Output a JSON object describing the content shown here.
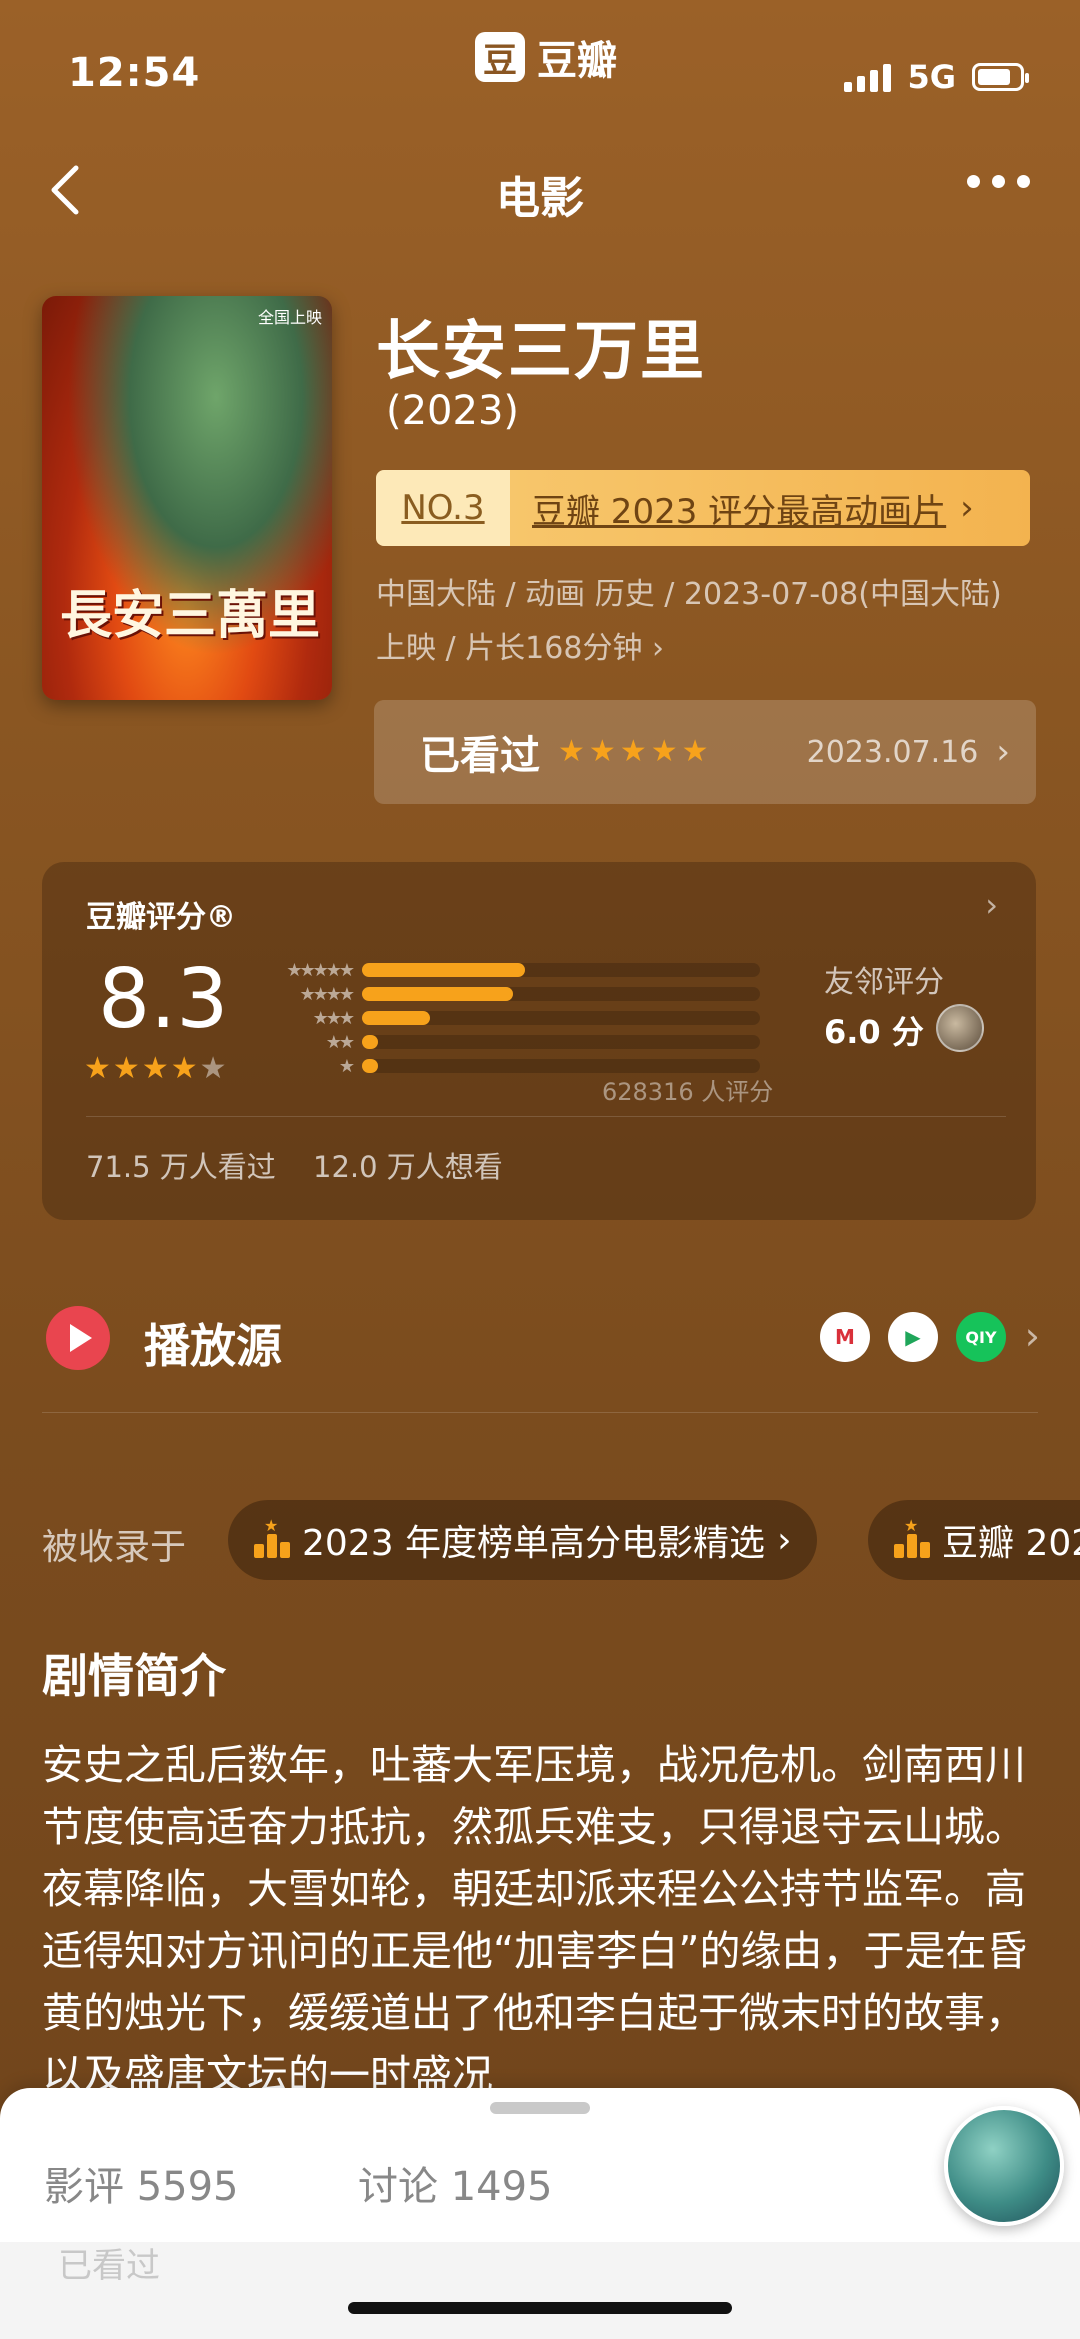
{
  "status_bar": {
    "time": "12:54",
    "network": "5G"
  },
  "app": {
    "logo_char": "豆",
    "name": "豆瓣"
  },
  "nav": {
    "title": "电影"
  },
  "movie": {
    "title": "长安三万里",
    "year": "(2023)",
    "poster_title": "長安三萬里",
    "poster_tag": "全国上映",
    "rank_no": "NO.3",
    "rank_label": "豆瓣 2023 评分最高动画片",
    "meta": "中国大陆 / 动画 历史 / 2023-07-08(中国大陆) 上映 / 片长168分钟",
    "meta_chev": "›"
  },
  "watched": {
    "label": "已看过",
    "stars": 5,
    "date": "2023.07.16",
    "chev": "›"
  },
  "rating": {
    "title": "豆瓣评分®",
    "score": "8.3",
    "stars": 4,
    "distribution": [
      0.41,
      0.38,
      0.17,
      0.04,
      0.04
    ],
    "count": "628316 人评分",
    "friend_label": "友邻评分",
    "friend_score": "6.0 分",
    "watched": "71.5 万人看过",
    "want": "12.0 万人想看",
    "chev": "›"
  },
  "play": {
    "label": "播放源",
    "sources": [
      "M",
      "▶",
      "QIY"
    ],
    "chev": "›"
  },
  "collected": {
    "label": "被收录于",
    "chips": [
      "2023 年度榜单高分电影精选",
      "豆瓣 202"
    ],
    "chev": "›"
  },
  "synopsis": {
    "title": "剧情简介",
    "text": "安史之乱后数年，吐蕃大军压境，战况危机。剑南西川节度使高适奋力抵抗，然孤兵难支，只得退守云山城。夜幕降临，大雪如轮，朝廷却派来程公公持节监军。高适得知对方讯问的正是他“加害李白”的缘由，于是在昏黄的烛光下，缓缓道出了他和李白起于微末时的故事，以及盛唐文坛的一时盛况"
  },
  "sheet": {
    "reviews": "影评 5595",
    "discussions": "讨论 1495",
    "faded": "已看过"
  },
  "colors": {
    "accent": "#f7a21b",
    "background": "#8a5622",
    "play": "#e9454f"
  }
}
